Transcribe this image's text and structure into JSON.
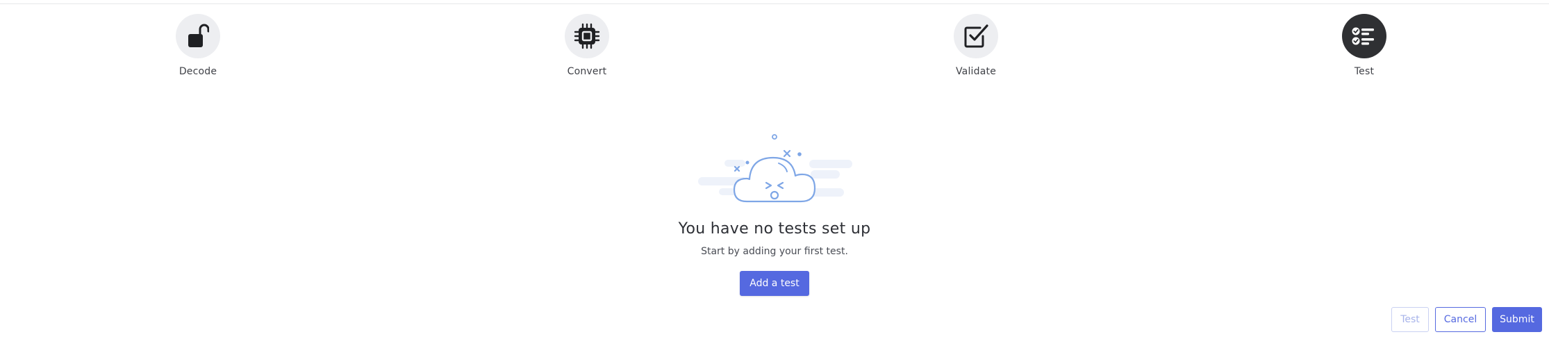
{
  "steps": [
    {
      "label": "Decode",
      "icon": "unlock-icon",
      "active": false
    },
    {
      "label": "Convert",
      "icon": "chip-icon",
      "active": false
    },
    {
      "label": "Validate",
      "icon": "checkbox-icon",
      "active": false
    },
    {
      "label": "Test",
      "icon": "checklist-icon",
      "active": true
    }
  ],
  "empty_state": {
    "illustration": "sad-cloud-illustration",
    "title": "You have no tests set up",
    "subtitle": "Start by adding your first test.",
    "add_button": "Add a test"
  },
  "footer": {
    "test_label": "Test",
    "cancel_label": "Cancel",
    "submit_label": "Submit"
  },
  "colors": {
    "accent": "#5569e0",
    "active_step": "#2f3033",
    "inactive_step": "#edeef1",
    "illustration": "#7ea6e6"
  }
}
